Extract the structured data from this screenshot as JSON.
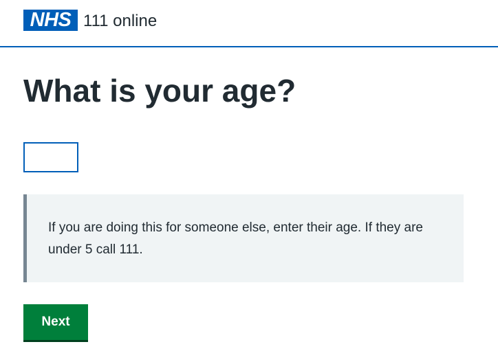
{
  "header": {
    "logo_text": "NHS",
    "service_name": "111 online"
  },
  "main": {
    "title": "What is your age?",
    "age_input": {
      "value": "",
      "placeholder": ""
    },
    "inset_text": "If you are doing this for someone else, enter their age. If they are under 5 call 111.",
    "next_label": "Next"
  },
  "colors": {
    "nhs_blue": "#005eb8",
    "button_green": "#007f3b",
    "inset_background": "#f0f4f5",
    "inset_border": "#768692",
    "text": "#212b32"
  }
}
